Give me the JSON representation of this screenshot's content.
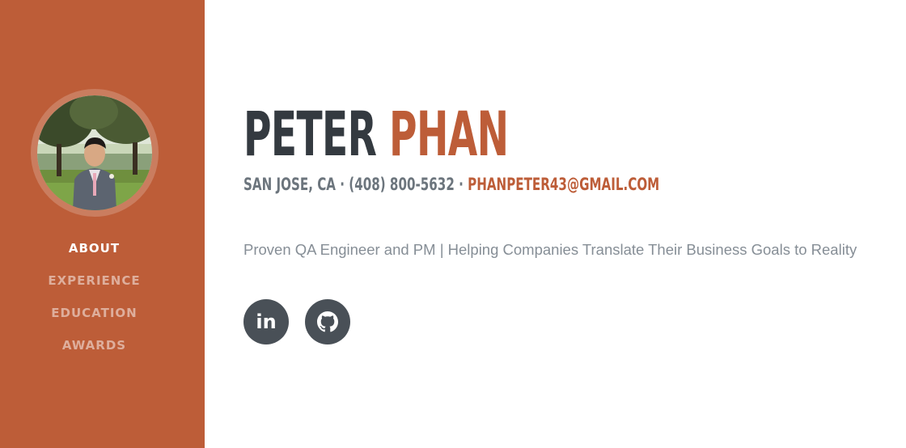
{
  "profile": {
    "first_name": "PETER",
    "last_name": "PHAN",
    "location_phone": "SAN JOSE, CA · (408) 800-5632 · ",
    "email": "PHANPETER43@GMAIL.COM",
    "tagline": "Proven QA Engineer and PM | Helping Companies Translate Their Business Goals to Reality"
  },
  "sidebar": {
    "nav_items": [
      {
        "label": "ABOUT",
        "active": true
      },
      {
        "label": "EXPERIENCE",
        "active": false
      },
      {
        "label": "EDUCATION",
        "active": false
      },
      {
        "label": "AWARDS",
        "active": false
      }
    ]
  },
  "social": [
    {
      "icon": "linkedin-icon",
      "glyph": "in"
    },
    {
      "icon": "github-icon"
    }
  ],
  "colors": {
    "accent": "#bd5d38",
    "dark": "#343a40",
    "muted": "#6c757d",
    "social_bg": "#495057"
  }
}
